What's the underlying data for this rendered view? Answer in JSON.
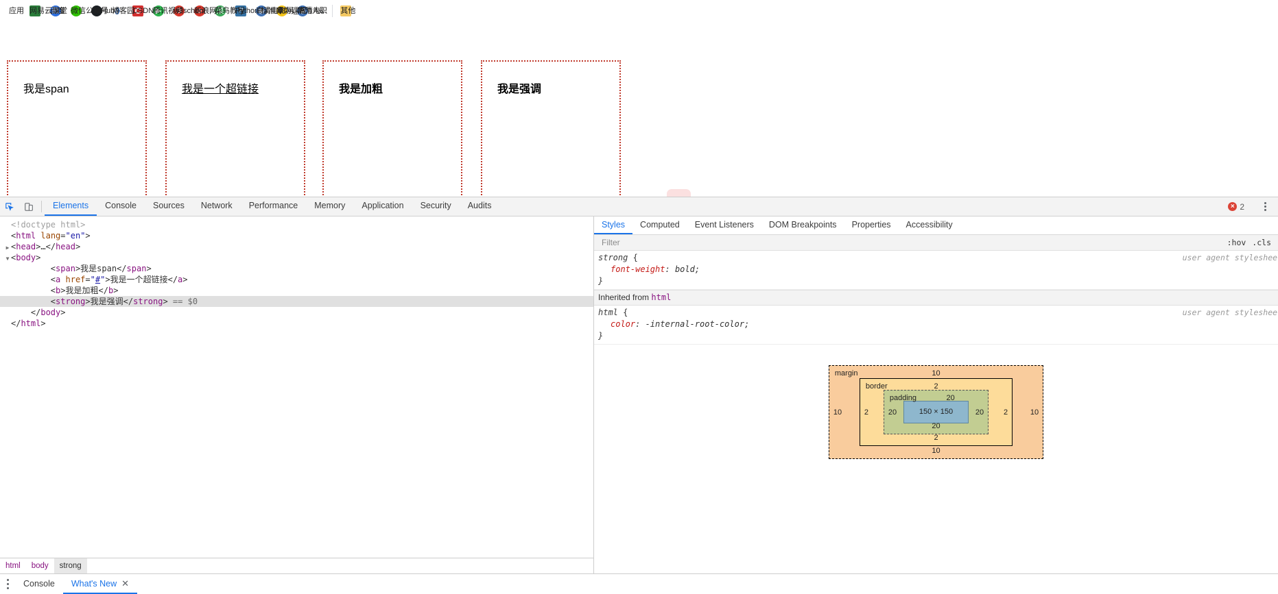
{
  "bookmarks": {
    "items": [
      {
        "label": "应用",
        "icon": "apps-grid-icon",
        "icon_class": "ico-apps",
        "glyph": ""
      },
      {
        "label": "网易云课堂",
        "icon": "netease-icon",
        "icon_class": "ico-book",
        "glyph": ""
      },
      {
        "label": "百度",
        "icon": "baidu-icon",
        "icon_class": "ico-baidu",
        "glyph": "熊"
      },
      {
        "label": "微信公众号",
        "icon": "wechat-icon",
        "icon_class": "ico-wechat",
        "glyph": ""
      },
      {
        "label": "GitHub",
        "icon": "github-icon",
        "icon_class": "ico-github",
        "glyph": ""
      },
      {
        "label": "博客园",
        "icon": "cnblogs-icon",
        "icon_class": "ico-cnblogs",
        "glyph": "ϑ"
      },
      {
        "label": "CSDN",
        "icon": "csdn-icon",
        "icon_class": "ico-csdn",
        "glyph": "C"
      },
      {
        "label": "腾讯视频",
        "icon": "tencent-video-icon",
        "icon_class": "ico-tencent",
        "glyph": "▶"
      },
      {
        "label": "w3school",
        "icon": "w3school-icon",
        "icon_class": "ico-w3",
        "glyph": "3"
      },
      {
        "label": "新浪网",
        "icon": "sina-icon",
        "icon_class": "ico-sina",
        "glyph": "e"
      },
      {
        "label": "菜鸟教程",
        "icon": "runoob-icon",
        "icon_class": "ico-runoob",
        "glyph": "菜"
      },
      {
        "label": "Python 标准库 —...",
        "icon": "python-icon",
        "icon_class": "ico-python",
        "glyph": "P"
      },
      {
        "label": "高清电影网_高清电...",
        "icon": "movie-site-icon",
        "icon_class": "ico-movie",
        "glyph": "◉"
      },
      {
        "label": "华为课程",
        "icon": "ict-icon",
        "icon_class": "ico-ict",
        "glyph": "ICT"
      },
      {
        "label": "华为入职",
        "icon": "huawei-icon",
        "icon_class": "ico-hw",
        "glyph": "◉"
      }
    ],
    "overflow_label": "»",
    "other_bookmarks": {
      "label": "其他",
      "icon": "folder-icon",
      "icon_class": "ico-folder",
      "glyph": ""
    }
  },
  "page": {
    "boxes": [
      {
        "text": "我是span",
        "kind": "span"
      },
      {
        "text": "我是一个超链接",
        "kind": "link"
      },
      {
        "text": "我是加粗",
        "kind": "bold"
      },
      {
        "text": "我是强调",
        "kind": "strong"
      }
    ],
    "watermark_icon": "search-icon"
  },
  "devtools": {
    "toolbar": {
      "inspect_icon": "inspect-element-icon",
      "device_icon": "device-toolbar-icon",
      "tabs": [
        {
          "label": "Elements",
          "active": true
        },
        {
          "label": "Console",
          "active": false
        },
        {
          "label": "Sources",
          "active": false
        },
        {
          "label": "Network",
          "active": false
        },
        {
          "label": "Performance",
          "active": false
        },
        {
          "label": "Memory",
          "active": false
        },
        {
          "label": "Application",
          "active": false
        },
        {
          "label": "Security",
          "active": false
        },
        {
          "label": "Audits",
          "active": false
        }
      ],
      "error_count": "2",
      "error_icon": "error-circle-icon",
      "menu_icon": "kebab-menu-icon"
    },
    "dom": {
      "lines": [
        {
          "indent": 0,
          "arrow": "",
          "html": "<span class=\"doctype\">&lt;!doctype html&gt;</span>"
        },
        {
          "indent": 0,
          "arrow": "",
          "html": "<span class=\"punc\">&lt;</span><span class=\"tag\">html</span> <span class=\"attr-name\">lang</span><span class=\"punc\">=</span><span class=\"attr-val\">\"en\"</span><span class=\"punc\">&gt;</span>"
        },
        {
          "indent": 0,
          "arrow": "▶",
          "html": "<span class=\"punc\">&lt;</span><span class=\"tag\">head</span><span class=\"punc\">&gt;</span><span class=\"txt\">…</span><span class=\"punc\">&lt;/</span><span class=\"tag\">head</span><span class=\"punc\">&gt;</span>"
        },
        {
          "indent": 0,
          "arrow": "▼",
          "html": "<span class=\"punc\">&lt;</span><span class=\"tag\">body</span><span class=\"punc\">&gt;</span>"
        },
        {
          "indent": 2,
          "arrow": "",
          "html": "<span class=\"punc\">&lt;</span><span class=\"tag\">span</span><span class=\"punc\">&gt;</span><span class=\"txt\">我是span</span><span class=\"punc\">&lt;/</span><span class=\"tag\">span</span><span class=\"punc\">&gt;</span>"
        },
        {
          "indent": 2,
          "arrow": "",
          "html": "<span class=\"punc\">&lt;</span><span class=\"tag\">a</span> <span class=\"attr-name\">href</span><span class=\"punc\">=</span><span class=\"attr-val\">\"</span><span class=\"href-link\">#</span><span class=\"attr-val\">\"</span><span class=\"punc\">&gt;</span><span class=\"txt\">我是一个超链接</span><span class=\"punc\">&lt;/</span><span class=\"tag\">a</span><span class=\"punc\">&gt;</span>"
        },
        {
          "indent": 2,
          "arrow": "",
          "html": "<span class=\"punc\">&lt;</span><span class=\"tag\">b</span><span class=\"punc\">&gt;</span><span class=\"txt\">我是加粗</span><span class=\"punc\">&lt;/</span><span class=\"tag\">b</span><span class=\"punc\">&gt;</span>"
        },
        {
          "indent": 2,
          "arrow": "",
          "selected": true,
          "html": "<span class=\"punc\">&lt;</span><span class=\"tag\">strong</span><span class=\"punc\">&gt;</span><span class=\"txt\">我是强调</span><span class=\"punc\">&lt;/</span><span class=\"tag\">strong</span><span class=\"punc\">&gt;</span> <span class=\"sel-marker\">== $0</span>"
        },
        {
          "indent": 1,
          "arrow": "",
          "html": "<span class=\"punc\">&lt;/</span><span class=\"tag\">body</span><span class=\"punc\">&gt;</span>"
        },
        {
          "indent": 0,
          "arrow": "",
          "html": "<span class=\"punc\">&lt;/</span><span class=\"tag\">html</span><span class=\"punc\">&gt;</span>"
        }
      ]
    },
    "breadcrumb": {
      "items": [
        {
          "label": "html",
          "active": false
        },
        {
          "label": "body",
          "active": false
        },
        {
          "label": "strong",
          "active": true
        }
      ]
    },
    "styles": {
      "tabs": [
        {
          "label": "Styles",
          "active": true
        },
        {
          "label": "Computed",
          "active": false
        },
        {
          "label": "Event Listeners",
          "active": false
        },
        {
          "label": "DOM Breakpoints",
          "active": false
        },
        {
          "label": "Properties",
          "active": false
        },
        {
          "label": "Accessibility",
          "active": false
        }
      ],
      "filter_placeholder": "Filter",
      "filter_value": "",
      "hov_label": ":hov",
      "cls_label": ".cls",
      "rules": [
        {
          "selector": "strong",
          "open_brace": "{",
          "close_brace": "}",
          "origin": "user agent stylesheet",
          "declarations": [
            {
              "name": "font-weight",
              "value": "bold;"
            }
          ]
        }
      ],
      "inherited_label": "Inherited from",
      "inherited_source": "html",
      "inherited_rules": [
        {
          "selector": "html",
          "open_brace": "{",
          "close_brace": "}",
          "origin": "user agent stylesheet",
          "declarations": [
            {
              "name": "color",
              "value": "-internal-root-color;"
            }
          ]
        }
      ],
      "box_model": {
        "margin_label": "margin",
        "margin_top": "10",
        "margin_right": "10",
        "margin_bottom": "10",
        "margin_left": "10",
        "border_label": "border",
        "border_top": "2",
        "border_right": "2",
        "border_bottom": "2",
        "border_left": "2",
        "padding_label": "padding",
        "padding_top": "20",
        "padding_right": "20",
        "padding_bottom": "20",
        "padding_left": "20",
        "content_size": "150 × 150"
      }
    },
    "drawer": {
      "menu_icon": "kebab-menu-icon",
      "tabs": [
        {
          "label": "Console",
          "active": false,
          "closable": false
        },
        {
          "label": "What's New",
          "active": true,
          "closable": true
        }
      ],
      "close_glyph": "✕"
    }
  }
}
